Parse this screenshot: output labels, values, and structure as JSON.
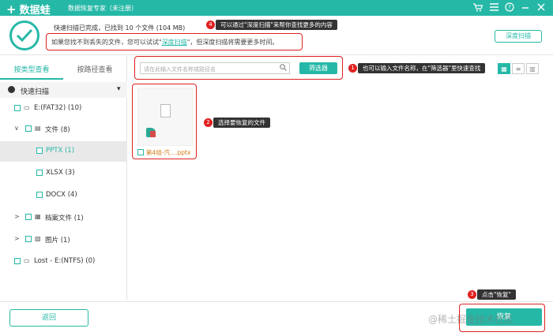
{
  "titlebar": {
    "logo_mark": "+",
    "app_name": "数据蛙",
    "subtitle": "数据恢复专家（未注册）",
    "icons": [
      "cart-icon",
      "menu-icon",
      "help-icon",
      "minimize-icon",
      "close-icon"
    ]
  },
  "header": {
    "scan_done": "快速扫描已完成，已找到 10 个文件 (104 MB)",
    "hint_prefix": "如果您找不到丢失的文件，您可以试试\"",
    "hint_link": "深度扫描",
    "hint_suffix": "\"，但深度扫描将需要更多时间。",
    "deep_scan_button": "深度扫描"
  },
  "tips": {
    "tip1": {
      "num": "1",
      "text": "也可以输入文件名称，在\"筛选器\"里快速查找"
    },
    "tip2": {
      "num": "2",
      "text": "选择要恢复的文件"
    },
    "tip3": {
      "num": "3",
      "text": "点击\"恢复\""
    },
    "tip4": {
      "num": "4",
      "text": "可以通过\"深度扫描\"来帮你查找更多的内容"
    }
  },
  "sidebar": {
    "tabs": [
      "按类型查看",
      "按路径查看"
    ],
    "quick_scan": "快速扫描",
    "tree": [
      {
        "label": "E:(FAT32) (10)"
      },
      {
        "label": "文件 (8)"
      },
      {
        "label": "PPTX (1)"
      },
      {
        "label": "XLSX (3)"
      },
      {
        "label": "DOCX (4)"
      },
      {
        "label": "档案文件 (1)"
      },
      {
        "label": "图片 (1)"
      },
      {
        "label": "Lost - E:(NTFS) (0)"
      }
    ]
  },
  "toolbar": {
    "search_placeholder": "请在此输入文件名称或路径名",
    "filter_button": "筛选器"
  },
  "files": [
    {
      "name": "第4组-汽....pptx"
    }
  ],
  "footer": {
    "back_button": "返回",
    "recover_button": "恢复",
    "watermark": "@稀土掘金技术社区"
  },
  "colors": {
    "accent": "#26b8a7",
    "annotation": "#e02020"
  }
}
